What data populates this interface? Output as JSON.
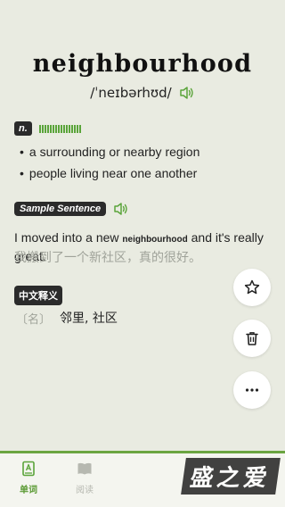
{
  "word": {
    "title": "neighbourhood",
    "phonetic": "/ˈneɪbərhʊd/"
  },
  "definitions": {
    "pos": "n.",
    "frequency_level": 1.0,
    "items": [
      {
        "text": "a surrounding or nearby region"
      },
      {
        "text": "people living near one another"
      }
    ]
  },
  "sample": {
    "badge": "Sample Sentence",
    "sentence_before": "I moved into a new ",
    "sentence_word": "neighbourhood",
    "sentence_after": " and it's really great.",
    "translation": "我搬到了一个新社区，真的很好。"
  },
  "chinese": {
    "badge": "中文释义",
    "pos": "〔名〕",
    "meaning": "邻里, 社区"
  },
  "tabs": {
    "words_label": "单词",
    "read_label": "阅读"
  },
  "watermark": {
    "text": "盛之爱"
  },
  "colors": {
    "accent": "#5aa43a",
    "background": "#e9ebe1",
    "badge": "#2b2b2b"
  },
  "icons": {
    "speaker": "speaker-icon",
    "star": "star-icon",
    "trash": "trash-icon",
    "more": "more-icon",
    "words_tab": "words-book-icon",
    "read_tab": "open-book-icon"
  }
}
